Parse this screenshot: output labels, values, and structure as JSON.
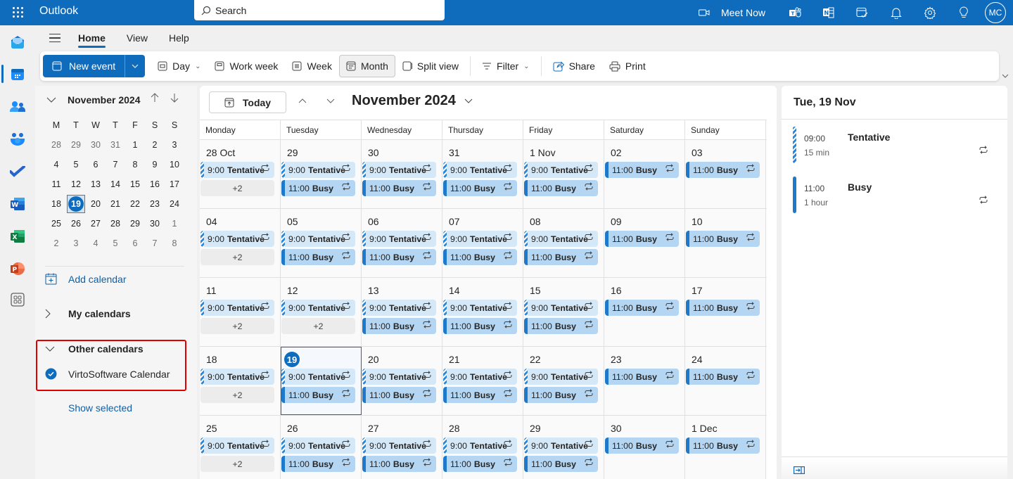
{
  "app": {
    "title": "Outlook",
    "search_placeholder": "Search"
  },
  "topbar": {
    "meet_now_label": "Meet Now",
    "icons": [
      "video-camera-icon",
      "teams-icon",
      "onenote-icon",
      "calendar-check-icon",
      "bell-icon",
      "gear-icon",
      "lightbulb-icon"
    ],
    "avatar_initials": "MC"
  },
  "rail": {
    "apps": [
      "mail",
      "calendar",
      "people",
      "groups",
      "todo",
      "word",
      "excel",
      "powerpoint",
      "more-apps"
    ],
    "active": "calendar"
  },
  "ribbon_tabs": [
    "Home",
    "View",
    "Help"
  ],
  "ribbon_active_tab": "Home",
  "ribbon": {
    "new_event": "New event",
    "day": "Day",
    "work_week": "Work week",
    "week": "Week",
    "month": "Month",
    "split_view": "Split view",
    "filter": "Filter",
    "share": "Share",
    "print": "Print",
    "active_view": "Month"
  },
  "mini_calendar": {
    "title": "November 2024",
    "dow": [
      "M",
      "T",
      "W",
      "T",
      "F",
      "S",
      "S"
    ],
    "weeks": [
      [
        {
          "d": "28",
          "dim": true
        },
        {
          "d": "29",
          "dim": true
        },
        {
          "d": "30",
          "dim": true
        },
        {
          "d": "31",
          "dim": true
        },
        {
          "d": "1"
        },
        {
          "d": "2"
        },
        {
          "d": "3"
        }
      ],
      [
        {
          "d": "4"
        },
        {
          "d": "5"
        },
        {
          "d": "6"
        },
        {
          "d": "7"
        },
        {
          "d": "8"
        },
        {
          "d": "9"
        },
        {
          "d": "10"
        }
      ],
      [
        {
          "d": "11"
        },
        {
          "d": "12"
        },
        {
          "d": "13"
        },
        {
          "d": "14"
        },
        {
          "d": "15"
        },
        {
          "d": "16"
        },
        {
          "d": "17"
        }
      ],
      [
        {
          "d": "18"
        },
        {
          "d": "19",
          "today": true
        },
        {
          "d": "20"
        },
        {
          "d": "21"
        },
        {
          "d": "22"
        },
        {
          "d": "23"
        },
        {
          "d": "24"
        }
      ],
      [
        {
          "d": "25"
        },
        {
          "d": "26"
        },
        {
          "d": "27"
        },
        {
          "d": "28"
        },
        {
          "d": "29"
        },
        {
          "d": "30"
        },
        {
          "d": "1",
          "dim": true
        }
      ],
      [
        {
          "d": "2",
          "dim": true
        },
        {
          "d": "3",
          "dim": true
        },
        {
          "d": "4",
          "dim": true
        },
        {
          "d": "5",
          "dim": true
        },
        {
          "d": "6",
          "dim": true
        },
        {
          "d": "7",
          "dim": true
        },
        {
          "d": "8",
          "dim": true
        }
      ]
    ]
  },
  "left_pane": {
    "add_calendar": "Add calendar",
    "my_calendars": "My calendars",
    "other_calendars": "Other calendars",
    "calendar_item": "VirtoSoftware Calendar",
    "calendar_item_checked": true,
    "show_selected": "Show selected"
  },
  "calendar": {
    "today_label": "Today",
    "title": "November 2024",
    "dow": [
      "Monday",
      "Tuesday",
      "Wednesday",
      "Thursday",
      "Friday",
      "Saturday",
      "Sunday"
    ],
    "weeks": [
      [
        {
          "label": "28 Oct",
          "events": [
            {
              "time": "9:00",
              "title": "Tentative",
              "type": "tent"
            }
          ],
          "more": "+2"
        },
        {
          "label": "29",
          "events": [
            {
              "time": "9:00",
              "title": "Tentative",
              "type": "tent"
            },
            {
              "time": "11:00",
              "title": "Busy",
              "type": "busy"
            }
          ]
        },
        {
          "label": "30",
          "events": [
            {
              "time": "9:00",
              "title": "Tentative",
              "type": "tent"
            },
            {
              "time": "11:00",
              "title": "Busy",
              "type": "busy"
            }
          ]
        },
        {
          "label": "31",
          "events": [
            {
              "time": "9:00",
              "title": "Tentative",
              "type": "tent"
            },
            {
              "time": "11:00",
              "title": "Busy",
              "type": "busy"
            }
          ]
        },
        {
          "label": "1 Nov",
          "events": [
            {
              "time": "9:00",
              "title": "Tentative",
              "type": "tent"
            },
            {
              "time": "11:00",
              "title": "Busy",
              "type": "busy"
            }
          ]
        },
        {
          "label": "02",
          "events": [
            {
              "time": "11:00",
              "title": "Busy",
              "type": "busy"
            }
          ]
        },
        {
          "label": "03",
          "events": [
            {
              "time": "11:00",
              "title": "Busy",
              "type": "busy"
            }
          ]
        }
      ],
      [
        {
          "label": "04",
          "events": [
            {
              "time": "9:00",
              "title": "Tentative",
              "type": "tent"
            }
          ],
          "more": "+2"
        },
        {
          "label": "05",
          "events": [
            {
              "time": "9:00",
              "title": "Tentative",
              "type": "tent"
            },
            {
              "time": "11:00",
              "title": "Busy",
              "type": "busy"
            }
          ]
        },
        {
          "label": "06",
          "events": [
            {
              "time": "9:00",
              "title": "Tentative",
              "type": "tent"
            },
            {
              "time": "11:00",
              "title": "Busy",
              "type": "busy"
            }
          ]
        },
        {
          "label": "07",
          "events": [
            {
              "time": "9:00",
              "title": "Tentative",
              "type": "tent"
            },
            {
              "time": "11:00",
              "title": "Busy",
              "type": "busy"
            }
          ]
        },
        {
          "label": "08",
          "events": [
            {
              "time": "9:00",
              "title": "Tentative",
              "type": "tent"
            },
            {
              "time": "11:00",
              "title": "Busy",
              "type": "busy"
            }
          ]
        },
        {
          "label": "09",
          "events": [
            {
              "time": "11:00",
              "title": "Busy",
              "type": "busy"
            }
          ]
        },
        {
          "label": "10",
          "events": [
            {
              "time": "11:00",
              "title": "Busy",
              "type": "busy"
            }
          ]
        }
      ],
      [
        {
          "label": "11",
          "events": [
            {
              "time": "9:00",
              "title": "Tentative",
              "type": "tent"
            }
          ],
          "more": "+2"
        },
        {
          "label": "12",
          "events": [
            {
              "time": "9:00",
              "title": "Tentative",
              "type": "tent"
            }
          ],
          "more": "+2"
        },
        {
          "label": "13",
          "events": [
            {
              "time": "9:00",
              "title": "Tentative",
              "type": "tent"
            },
            {
              "time": "11:00",
              "title": "Busy",
              "type": "busy"
            }
          ]
        },
        {
          "label": "14",
          "events": [
            {
              "time": "9:00",
              "title": "Tentative",
              "type": "tent"
            },
            {
              "time": "11:00",
              "title": "Busy",
              "type": "busy"
            }
          ]
        },
        {
          "label": "15",
          "events": [
            {
              "time": "9:00",
              "title": "Tentative",
              "type": "tent"
            },
            {
              "time": "11:00",
              "title": "Busy",
              "type": "busy"
            }
          ]
        },
        {
          "label": "16",
          "events": [
            {
              "time": "11:00",
              "title": "Busy",
              "type": "busy"
            }
          ]
        },
        {
          "label": "17",
          "events": [
            {
              "time": "11:00",
              "title": "Busy",
              "type": "busy"
            }
          ]
        }
      ],
      [
        {
          "label": "18",
          "events": [
            {
              "time": "9:00",
              "title": "Tentative",
              "type": "tent"
            }
          ],
          "more": "+2"
        },
        {
          "label": "19",
          "today": true,
          "events": [
            {
              "time": "9:00",
              "title": "Tentative",
              "type": "tent"
            },
            {
              "time": "11:00",
              "title": "Busy",
              "type": "busy"
            }
          ]
        },
        {
          "label": "20",
          "events": [
            {
              "time": "9:00",
              "title": "Tentative",
              "type": "tent"
            },
            {
              "time": "11:00",
              "title": "Busy",
              "type": "busy"
            }
          ]
        },
        {
          "label": "21",
          "events": [
            {
              "time": "9:00",
              "title": "Tentative",
              "type": "tent"
            },
            {
              "time": "11:00",
              "title": "Busy",
              "type": "busy"
            }
          ]
        },
        {
          "label": "22",
          "events": [
            {
              "time": "9:00",
              "title": "Tentative",
              "type": "tent"
            },
            {
              "time": "11:00",
              "title": "Busy",
              "type": "busy"
            }
          ]
        },
        {
          "label": "23",
          "events": [
            {
              "time": "11:00",
              "title": "Busy",
              "type": "busy"
            }
          ]
        },
        {
          "label": "24",
          "events": [
            {
              "time": "11:00",
              "title": "Busy",
              "type": "busy"
            }
          ]
        }
      ],
      [
        {
          "label": "25",
          "events": [
            {
              "time": "9:00",
              "title": "Tentative",
              "type": "tent"
            }
          ],
          "more": "+2"
        },
        {
          "label": "26",
          "events": [
            {
              "time": "9:00",
              "title": "Tentative",
              "type": "tent"
            },
            {
              "time": "11:00",
              "title": "Busy",
              "type": "busy"
            }
          ]
        },
        {
          "label": "27",
          "events": [
            {
              "time": "9:00",
              "title": "Tentative",
              "type": "tent"
            },
            {
              "time": "11:00",
              "title": "Busy",
              "type": "busy"
            }
          ]
        },
        {
          "label": "28",
          "events": [
            {
              "time": "9:00",
              "title": "Tentative",
              "type": "tent"
            },
            {
              "time": "11:00",
              "title": "Busy",
              "type": "busy"
            }
          ]
        },
        {
          "label": "29",
          "events": [
            {
              "time": "9:00",
              "title": "Tentative",
              "type": "tent"
            },
            {
              "time": "11:00",
              "title": "Busy",
              "type": "busy"
            }
          ]
        },
        {
          "label": "30",
          "events": [
            {
              "time": "11:00",
              "title": "Busy",
              "type": "busy"
            }
          ]
        },
        {
          "label": "1 Dec",
          "events": [
            {
              "time": "11:00",
              "title": "Busy",
              "type": "busy"
            }
          ]
        }
      ]
    ]
  },
  "side_panel": {
    "title": "Tue, 19 Nov",
    "events": [
      {
        "time": "09:00",
        "duration": "15 min",
        "title": "Tentative",
        "type": "tent"
      },
      {
        "time": "11:00",
        "duration": "1 hour",
        "title": "Busy",
        "type": "busy"
      }
    ]
  },
  "colors": {
    "brand": "#0f6cbd",
    "tentative_bg": "#d4e8f8",
    "busy_bg": "#b4d6f2",
    "highlight_box": "#e00000"
  }
}
